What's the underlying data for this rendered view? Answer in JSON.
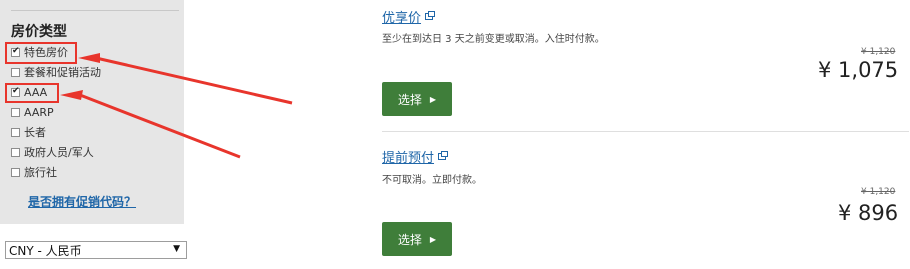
{
  "filters": {
    "title": "房价类型",
    "options": [
      {
        "label": "特色房价",
        "checked": true
      },
      {
        "label": "套餐和促销活动",
        "checked": false
      },
      {
        "label": "AAA",
        "checked": true
      },
      {
        "label": "AARP",
        "checked": false
      },
      {
        "label": "长者",
        "checked": false
      },
      {
        "label": "政府人员/军人",
        "checked": false
      },
      {
        "label": "旅行社",
        "checked": false
      }
    ],
    "promo_link": "是否拥有促销代码？"
  },
  "currency": {
    "selected": "CNY - 人民币"
  },
  "rates": [
    {
      "name": "优享价",
      "description": "至少在到达日 3 天之前变更或取消。入住时付款。",
      "old_price": "¥ 1,120",
      "price": "¥ 1,075",
      "button": "选择"
    },
    {
      "name": "提前预付",
      "description": "不可取消。立即付款。",
      "old_price": "¥ 1,120",
      "price": "¥ 896",
      "button": "选择"
    }
  ],
  "colors": {
    "accent_link": "#1f66a8",
    "button_green": "#3f7e3a",
    "annotation_red": "#e8352c",
    "sidebar_bg": "#e6e6e6"
  }
}
